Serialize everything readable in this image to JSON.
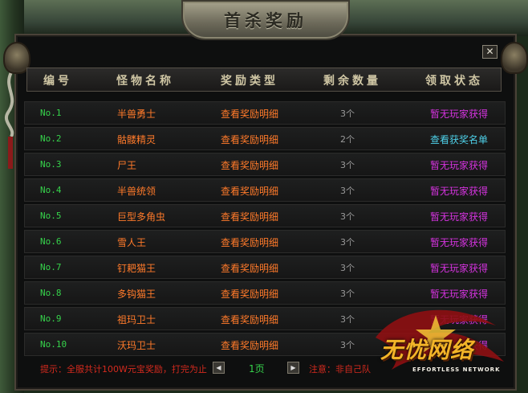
{
  "window": {
    "title": "首杀奖励",
    "close_label": "✕"
  },
  "columns": [
    "编号",
    "怪物名称",
    "奖励类型",
    "剩余数量",
    "领取状态"
  ],
  "rows": [
    {
      "no": "No.1",
      "name": "半兽勇士",
      "type": "查看奖励明细",
      "left": "3个",
      "status": "暂无玩家获得"
    },
    {
      "no": "No.2",
      "name": "骷髅精灵",
      "type": "查看奖励明细",
      "left": "2个",
      "status": "查看获奖名单"
    },
    {
      "no": "No.3",
      "name": "尸王",
      "type": "查看奖励明细",
      "left": "3个",
      "status": "暂无玩家获得"
    },
    {
      "no": "No.4",
      "name": "半兽统领",
      "type": "查看奖励明细",
      "left": "3个",
      "status": "暂无玩家获得"
    },
    {
      "no": "No.5",
      "name": "巨型多角虫",
      "type": "查看奖励明细",
      "left": "3个",
      "status": "暂无玩家获得"
    },
    {
      "no": "No.6",
      "name": "雪人王",
      "type": "查看奖励明细",
      "left": "3个",
      "status": "暂无玩家获得"
    },
    {
      "no": "No.7",
      "name": "钉耙猫王",
      "type": "查看奖励明细",
      "left": "3个",
      "status": "暂无玩家获得"
    },
    {
      "no": "No.8",
      "name": "多钩猫王",
      "type": "查看奖励明细",
      "left": "3个",
      "status": "暂无玩家获得"
    },
    {
      "no": "No.9",
      "name": "祖玛卫士",
      "type": "查看奖励明细",
      "left": "3个",
      "status": "暂无玩家获得"
    },
    {
      "no": "No.10",
      "name": "沃玛卫士",
      "type": "查看奖励明细",
      "left": "3个",
      "status": "暂无玩家获得"
    }
  ],
  "footer": {
    "tip": "提示：全服共计100W元宝奖励，打完为止",
    "prev_label": "◀",
    "page": "1页",
    "next_label": "▶",
    "note": "注意：非自己队"
  },
  "logo": {
    "text": "无忧网络",
    "sub": "EFFORTLESS NETWORK"
  },
  "colors": {
    "status_none": "#d633e0",
    "status_list": "#4ed0e8",
    "green": "#36d24b",
    "orange": "#ff7a2a",
    "red": "#d42a1e"
  }
}
